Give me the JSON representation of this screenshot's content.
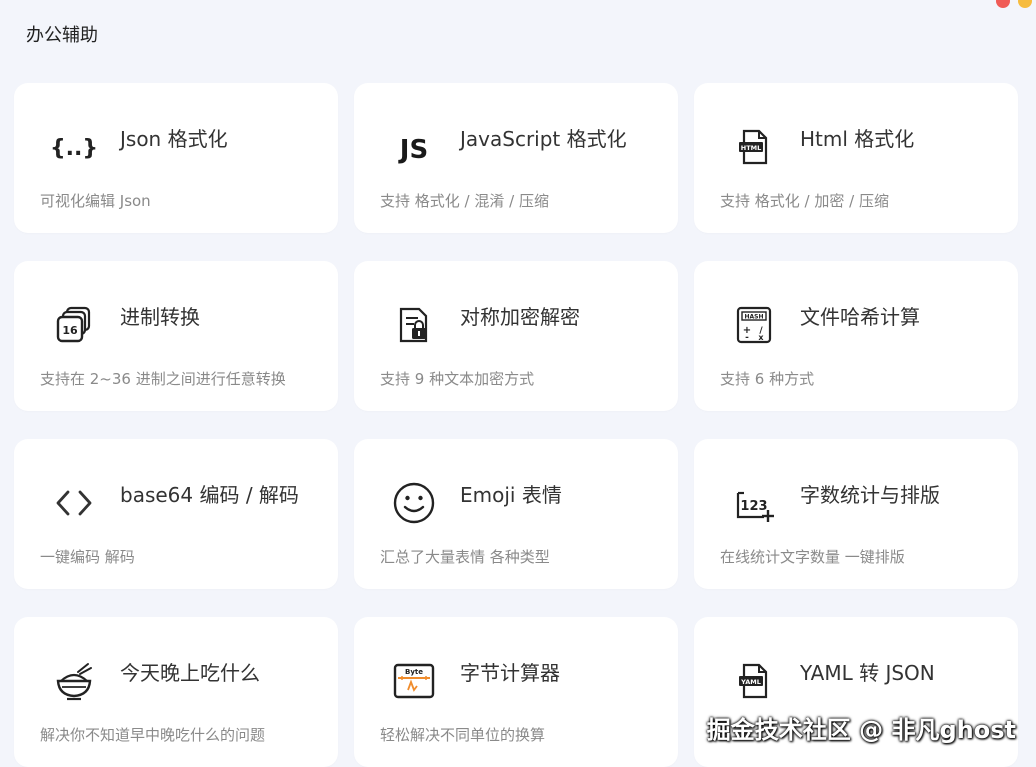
{
  "page": {
    "title": "办公辅助"
  },
  "window_controls": {
    "colors": [
      "#f05b56",
      "#f6bc3f"
    ]
  },
  "cards": [
    {
      "title": "Json 格式化",
      "desc": "可视化编辑 Json",
      "icon": "json-braces-icon"
    },
    {
      "title": "JavaScript 格式化",
      "desc": "支持 格式化 / 混淆 / 压缩",
      "icon": "javascript-icon",
      "icon_label": "JS"
    },
    {
      "title": "Html 格式化",
      "desc": "支持 格式化 / 加密 / 压缩",
      "icon": "html-file-icon",
      "icon_label": "HTML"
    },
    {
      "title": "进制转换",
      "desc": "支持在 2~36 进制之间进行任意转换",
      "icon": "number-base-icon",
      "icon_label": "16"
    },
    {
      "title": "对称加密解密",
      "desc": "支持 9 种文本加密方式",
      "icon": "lock-document-icon"
    },
    {
      "title": "文件哈希计算",
      "desc": "支持 6 种方式",
      "icon": "hash-calculator-icon",
      "icon_label": "HASH"
    },
    {
      "title": "base64 编码 / 解码",
      "desc": "一键编码 解码",
      "icon": "code-brackets-icon"
    },
    {
      "title": "Emoji 表情",
      "desc": "汇总了大量表情 各种类型",
      "icon": "smiley-face-icon"
    },
    {
      "title": "字数统计与排版",
      "desc": "在线统计文字数量 一键排版",
      "icon": "word-count-icon",
      "icon_label": "123"
    },
    {
      "title": "今天晚上吃什么",
      "desc": "解决你不知道早中晚吃什么的问题",
      "icon": "rice-bowl-icon"
    },
    {
      "title": "字节计算器",
      "desc": "轻松解决不同单位的换算",
      "icon": "byte-calculator-icon",
      "icon_label": "Byte"
    },
    {
      "title": "YAML 转 JSON",
      "desc": "",
      "icon": "yaml-file-icon",
      "icon_label": "YAML"
    }
  ],
  "watermark": {
    "text": "掘金技术社区 @ 非凡ghost"
  },
  "colors": {
    "background": "#f3f5fb",
    "card": "#ffffff",
    "accent_orange": "#f08c2c"
  }
}
